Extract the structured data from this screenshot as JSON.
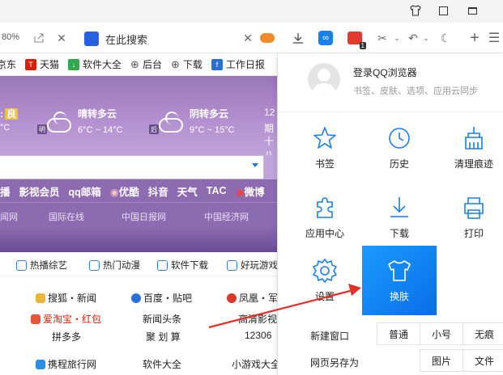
{
  "toolbar": {
    "zoom": "80%",
    "search_placeholder": "在此搜索"
  },
  "bookmarks": [
    {
      "label": "京东",
      "icon": "jd-icon",
      "color": "#ffffff"
    },
    {
      "label": "天猫",
      "icon": "tmall-icon",
      "color": "#d81e06"
    },
    {
      "label": "软件大全",
      "icon": "download-icon",
      "color": "#2fa84f"
    },
    {
      "label": "后台",
      "icon": "globe-icon",
      "color": "#555555"
    },
    {
      "label": "下载",
      "icon": "globe-icon",
      "color": "#555555"
    },
    {
      "label": "工作日报",
      "icon": "doc-icon",
      "color": "#2b6fd6"
    }
  ],
  "weather": {
    "aqi": "良",
    "today_temp": "°C",
    "tomorrow": {
      "tag": "明",
      "desc": "晴转多云",
      "temp": "6°C ~ 14°C"
    },
    "after": {
      "tag": "后",
      "desc": "阴转多云",
      "temp": "9°C ~ 15°C"
    },
    "date_num": "12",
    "date_week": "期",
    "date_extra": "十八"
  },
  "links_row": [
    "播",
    "影视会员",
    "qq邮箱",
    "优酷",
    "抖音",
    "天气",
    "TAC",
    "微博"
  ],
  "news_row": [
    "闻网",
    "国际在线",
    "中国日报网",
    "中国经济网"
  ],
  "categories": [
    "热播综艺",
    "热门动漫",
    "软件下载",
    "好玩游戏"
  ],
  "sites": {
    "row1": [
      "搜狐・新闻",
      "百度・贴吧",
      "凤凰・军"
    ],
    "row2": [
      "爱淘宝・红包",
      "新闻头条",
      "高清影视"
    ],
    "row3": [
      "拼多多",
      "聚 划 算",
      "12306"
    ],
    "row4": [
      "携程旅行网",
      "软件大全",
      "小游戏大全"
    ]
  },
  "menu": {
    "login": "登录QQ浏览器",
    "login_sub": "书签、皮肤、选项、应用云同步",
    "items": [
      {
        "label": "书签",
        "icon": "star-icon"
      },
      {
        "label": "历史",
        "icon": "clock-icon"
      },
      {
        "label": "清理痕迹",
        "icon": "broom-icon"
      },
      {
        "label": "应用中心",
        "icon": "puzzle-icon"
      },
      {
        "label": "下载",
        "icon": "download-arrow-icon"
      },
      {
        "label": "打印",
        "icon": "printer-icon"
      },
      {
        "label": "设置",
        "icon": "gear-icon"
      },
      {
        "label": "换肤",
        "icon": "shirt-icon"
      }
    ],
    "new_window": {
      "label": "新建窗口",
      "options": [
        "普通",
        "小号",
        "无痕"
      ]
    },
    "save_as": {
      "label": "网页另存为",
      "options": [
        "图片",
        "文件"
      ]
    }
  },
  "colors": {
    "accent": "#1a8cff",
    "purple": "#9a77b5",
    "arrow": "#e0302a"
  }
}
